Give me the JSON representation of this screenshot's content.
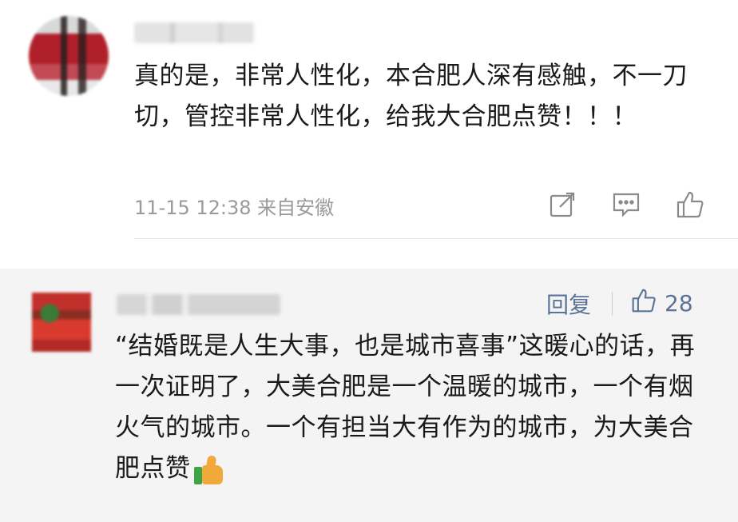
{
  "comment1": {
    "text": "真的是，非常人性化，本合肥人深有感触，不一刀切，管控非常人性化，给我大合肥点赞！！！",
    "meta": "11-15 12:38  来自安徽",
    "icons": [
      "share-icon",
      "comment-icon",
      "like-icon"
    ]
  },
  "comment2": {
    "reply_label": "回复",
    "like_count": "28",
    "text": "“结婚既是人生大事，也是城市喜事”这暖心的话，再一次证明了，大美合肥是一个温暖的城市，一个有烟火气的城市。一个有担当大有作为的城市，为大美合肥点赞",
    "emoji": "thumbs-up-emoji"
  },
  "colors": {
    "link": "#5a7496",
    "meta": "#9a9a9a",
    "reply_bg": "#f4f4f4"
  }
}
